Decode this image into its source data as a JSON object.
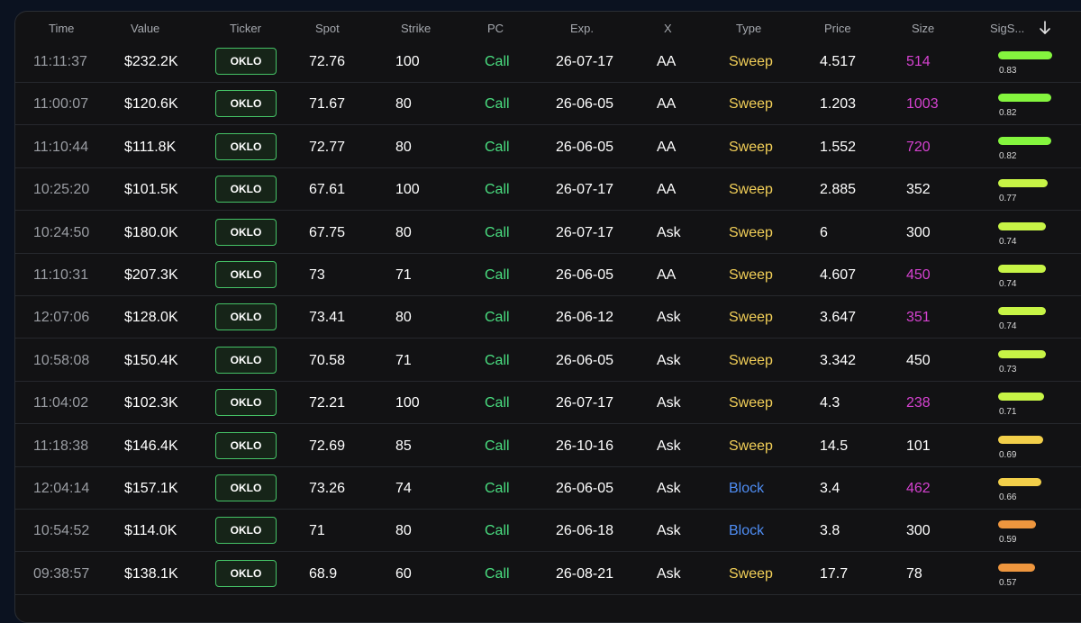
{
  "columns": {
    "time": "Time",
    "value": "Value",
    "ticker": "Ticker",
    "spot": "Spot",
    "strike": "Strike",
    "pc": "PC",
    "exp": "Exp.",
    "x": "X",
    "type": "Type",
    "price": "Price",
    "size": "Size",
    "sig": "SigS..."
  },
  "sort_icon": "arrow-down-icon",
  "colors": {
    "call": "#4ade80",
    "sweep": "#f2cf58",
    "block": "#4f8ef5",
    "size_highlight": "#d542d0",
    "ticker_border": "#45c266"
  },
  "rows": [
    {
      "time": "11:11:37",
      "value": "$232.2K",
      "ticker": "OKLO",
      "spot": "72.76",
      "strike": "100",
      "pc": "Call",
      "exp": "26-07-17",
      "x": "AA",
      "type": "Sweep",
      "price": "4.517",
      "size": "514",
      "size_hot": true,
      "sig": "0.83"
    },
    {
      "time": "11:00:07",
      "value": "$120.6K",
      "ticker": "OKLO",
      "spot": "71.67",
      "strike": "80",
      "pc": "Call",
      "exp": "26-06-05",
      "x": "AA",
      "type": "Sweep",
      "price": "1.203",
      "size": "1003",
      "size_hot": true,
      "sig": "0.82"
    },
    {
      "time": "11:10:44",
      "value": "$111.8K",
      "ticker": "OKLO",
      "spot": "72.77",
      "strike": "80",
      "pc": "Call",
      "exp": "26-06-05",
      "x": "AA",
      "type": "Sweep",
      "price": "1.552",
      "size": "720",
      "size_hot": true,
      "sig": "0.82"
    },
    {
      "time": "10:25:20",
      "value": "$101.5K",
      "ticker": "OKLO",
      "spot": "67.61",
      "strike": "100",
      "pc": "Call",
      "exp": "26-07-17",
      "x": "AA",
      "type": "Sweep",
      "price": "2.885",
      "size": "352",
      "size_hot": false,
      "sig": "0.77"
    },
    {
      "time": "10:24:50",
      "value": "$180.0K",
      "ticker": "OKLO",
      "spot": "67.75",
      "strike": "80",
      "pc": "Call",
      "exp": "26-07-17",
      "x": "Ask",
      "type": "Sweep",
      "price": "6",
      "size": "300",
      "size_hot": false,
      "sig": "0.74"
    },
    {
      "time": "11:10:31",
      "value": "$207.3K",
      "ticker": "OKLO",
      "spot": "73",
      "strike": "71",
      "pc": "Call",
      "exp": "26-06-05",
      "x": "AA",
      "type": "Sweep",
      "price": "4.607",
      "size": "450",
      "size_hot": true,
      "sig": "0.74"
    },
    {
      "time": "12:07:06",
      "value": "$128.0K",
      "ticker": "OKLO",
      "spot": "73.41",
      "strike": "80",
      "pc": "Call",
      "exp": "26-06-12",
      "x": "Ask",
      "type": "Sweep",
      "price": "3.647",
      "size": "351",
      "size_hot": true,
      "sig": "0.74"
    },
    {
      "time": "10:58:08",
      "value": "$150.4K",
      "ticker": "OKLO",
      "spot": "70.58",
      "strike": "71",
      "pc": "Call",
      "exp": "26-06-05",
      "x": "Ask",
      "type": "Sweep",
      "price": "3.342",
      "size": "450",
      "size_hot": false,
      "sig": "0.73"
    },
    {
      "time": "11:04:02",
      "value": "$102.3K",
      "ticker": "OKLO",
      "spot": "72.21",
      "strike": "100",
      "pc": "Call",
      "exp": "26-07-17",
      "x": "Ask",
      "type": "Sweep",
      "price": "4.3",
      "size": "238",
      "size_hot": true,
      "sig": "0.71"
    },
    {
      "time": "11:18:38",
      "value": "$146.4K",
      "ticker": "OKLO",
      "spot": "72.69",
      "strike": "85",
      "pc": "Call",
      "exp": "26-10-16",
      "x": "Ask",
      "type": "Sweep",
      "price": "14.5",
      "size": "101",
      "size_hot": false,
      "sig": "0.69"
    },
    {
      "time": "12:04:14",
      "value": "$157.1K",
      "ticker": "OKLO",
      "spot": "73.26",
      "strike": "74",
      "pc": "Call",
      "exp": "26-06-05",
      "x": "Ask",
      "type": "Block",
      "price": "3.4",
      "size": "462",
      "size_hot": true,
      "sig": "0.66"
    },
    {
      "time": "10:54:52",
      "value": "$114.0K",
      "ticker": "OKLO",
      "spot": "71",
      "strike": "80",
      "pc": "Call",
      "exp": "26-06-18",
      "x": "Ask",
      "type": "Block",
      "price": "3.8",
      "size": "300",
      "size_hot": false,
      "sig": "0.59"
    },
    {
      "time": "09:38:57",
      "value": "$138.1K",
      "ticker": "OKLO",
      "spot": "68.9",
      "strike": "60",
      "pc": "Call",
      "exp": "26-08-21",
      "x": "Ask",
      "type": "Sweep",
      "price": "17.7",
      "size": "78",
      "size_hot": false,
      "sig": "0.57"
    }
  ]
}
